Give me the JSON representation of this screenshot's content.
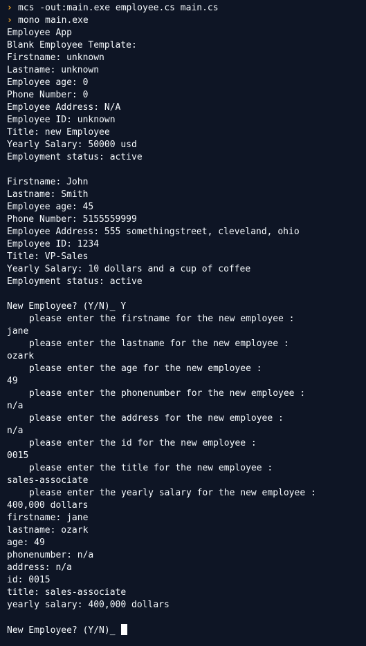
{
  "theme": {
    "background": "#0e1525",
    "foreground": "#f5f9fc",
    "prompt_color": "#f5a623",
    "cursor_color": "#ffffff"
  },
  "commands": [
    {
      "prompt": "›",
      "text": "mcs -out:main.exe employee.cs main.cs"
    },
    {
      "prompt": "›",
      "text": "mono main.exe"
    }
  ],
  "app_header": {
    "title": "Employee App",
    "template_label": "Blank Employee Template:"
  },
  "blank_template": [
    "Firstname: unknown",
    "Lastname: unknown",
    "Employee age: 0",
    "Phone Number: 0",
    "Employee Address: N/A",
    "Employee ID: unknown",
    "Title: new Employee",
    "Yearly Salary: 50000 usd",
    "Employment status: active"
  ],
  "employee_record": [
    "Firstname: John",
    "Lastname: Smith",
    "Employee age: 45",
    "Phone Number: 5155559999",
    "Employee Address: 555 somethingstreet, cleveland, ohio",
    "Employee ID: 1234",
    "Title: VP-Sales",
    "Yearly Salary: 10 dollars and a cup of coffee",
    "Employment status: active"
  ],
  "new_employee_prompt": "New Employee? (Y/N)_ Y",
  "entries": [
    {
      "question": "please enter the firstname for the new employee :",
      "answer": "jane"
    },
    {
      "question": "please enter the lastname for the new employee :",
      "answer": "ozark"
    },
    {
      "question": "please enter the age for the new employee :",
      "answer": "49"
    },
    {
      "question": "please enter the phonenumber for the new employee :",
      "answer": "n/a"
    },
    {
      "question": "please enter the address for the new employee :",
      "answer": "n/a"
    },
    {
      "question": "please enter the id for the new employee :",
      "answer": "0015"
    },
    {
      "question": "please enter the title for the new employee :",
      "answer": "sales-associate"
    },
    {
      "question": "please enter the yearly salary for the new employee :",
      "answer": "400,000 dollars"
    }
  ],
  "new_record": [
    "firstname: jane",
    "lastname: ozark",
    "age: 49",
    "phonenumber: n/a",
    "address: n/a",
    "id: 0015",
    "title: sales-associate",
    "yearly salary: 400,000 dollars"
  ],
  "final_prompt": "New Employee? (Y/N)_"
}
